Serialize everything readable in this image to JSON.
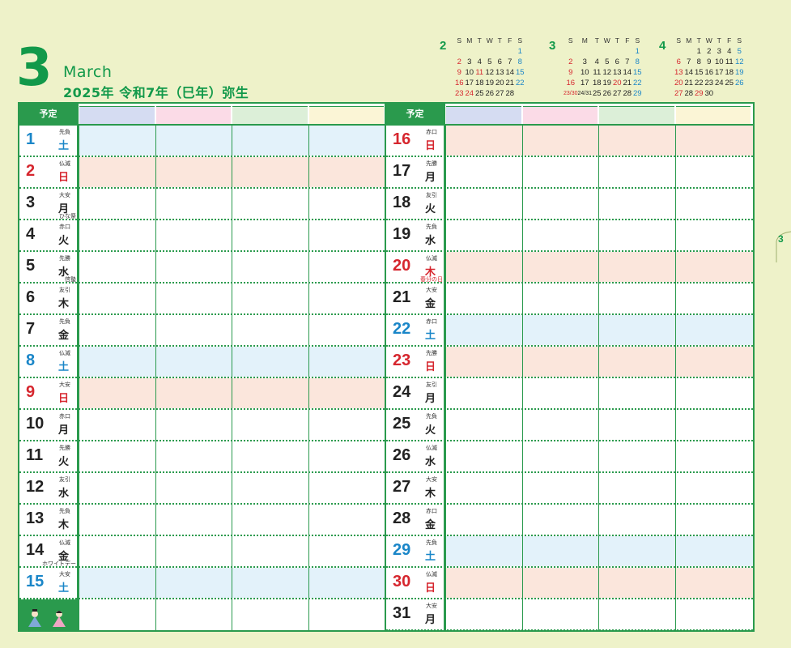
{
  "header": {
    "month_num": "3",
    "month_en": "March",
    "month_jp": "2025年 令和7年（巳年）弥生"
  },
  "mini_calendars": [
    {
      "month": "2",
      "headers": [
        "S",
        "M",
        "T",
        "W",
        "T",
        "F",
        "S"
      ],
      "weeks": [
        [
          "",
          "",
          "",
          "",
          "",
          "",
          "1"
        ],
        [
          "2",
          "3",
          "4",
          "5",
          "6",
          "7",
          "8"
        ],
        [
          "9",
          "10",
          "11",
          "12",
          "13",
          "14",
          "15"
        ],
        [
          "16",
          "17",
          "18",
          "19",
          "20",
          "21",
          "22"
        ],
        [
          "23",
          "24",
          "25",
          "26",
          "27",
          "28",
          ""
        ]
      ]
    },
    {
      "month": "3",
      "headers": [
        "S",
        "M",
        "T",
        "W",
        "T",
        "F",
        "S"
      ],
      "weeks": [
        [
          "",
          "",
          "",
          "",
          "",
          "",
          "1"
        ],
        [
          "2",
          "3",
          "4",
          "5",
          "6",
          "7",
          "8"
        ],
        [
          "9",
          "10",
          "11",
          "12",
          "13",
          "14",
          "15"
        ],
        [
          "16",
          "17",
          "18",
          "19",
          "20",
          "21",
          "22"
        ],
        [
          "23/30",
          "24/31",
          "25",
          "26",
          "27",
          "28",
          "29"
        ]
      ]
    },
    {
      "month": "4",
      "headers": [
        "S",
        "M",
        "T",
        "W",
        "T",
        "F",
        "S"
      ],
      "weeks": [
        [
          "",
          "",
          "1",
          "2",
          "3",
          "4",
          "5"
        ],
        [
          "6",
          "7",
          "8",
          "9",
          "10",
          "11",
          "12"
        ],
        [
          "13",
          "14",
          "15",
          "16",
          "17",
          "18",
          "19"
        ],
        [
          "20",
          "21",
          "22",
          "23",
          "24",
          "25",
          "26"
        ],
        [
          "27",
          "28",
          "29",
          "30",
          "",
          "",
          ""
        ]
      ]
    }
  ],
  "grid": {
    "yotei_label": "予定",
    "col_colors": [
      "#d5dcf2",
      "#fbdbe7",
      "#dcefd8",
      "#fbf5d6"
    ]
  },
  "days_left": [
    {
      "n": "1",
      "r": "先負",
      "d": "土",
      "type": "sat",
      "note": ""
    },
    {
      "n": "2",
      "r": "仏滅",
      "d": "日",
      "type": "sun",
      "note": ""
    },
    {
      "n": "3",
      "r": "大安",
      "d": "月",
      "type": "",
      "note": "ひな祭"
    },
    {
      "n": "4",
      "r": "赤口",
      "d": "火",
      "type": "",
      "note": ""
    },
    {
      "n": "5",
      "r": "先勝",
      "d": "水",
      "type": "",
      "note": "啓蟄"
    },
    {
      "n": "6",
      "r": "友引",
      "d": "木",
      "type": "",
      "note": ""
    },
    {
      "n": "7",
      "r": "先負",
      "d": "金",
      "type": "",
      "note": ""
    },
    {
      "n": "8",
      "r": "仏滅",
      "d": "土",
      "type": "sat",
      "note": ""
    },
    {
      "n": "9",
      "r": "大安",
      "d": "日",
      "type": "sun",
      "note": ""
    },
    {
      "n": "10",
      "r": "赤口",
      "d": "月",
      "type": "",
      "note": ""
    },
    {
      "n": "11",
      "r": "先勝",
      "d": "火",
      "type": "",
      "note": ""
    },
    {
      "n": "12",
      "r": "友引",
      "d": "水",
      "type": "",
      "note": ""
    },
    {
      "n": "13",
      "r": "先負",
      "d": "木",
      "type": "",
      "note": ""
    },
    {
      "n": "14",
      "r": "仏滅",
      "d": "金",
      "type": "",
      "note": "ホワイトデー"
    },
    {
      "n": "15",
      "r": "大安",
      "d": "土",
      "type": "sat",
      "note": ""
    }
  ],
  "days_right": [
    {
      "n": "16",
      "r": "赤口",
      "d": "日",
      "type": "sun",
      "note": ""
    },
    {
      "n": "17",
      "r": "先勝",
      "d": "月",
      "type": "",
      "note": ""
    },
    {
      "n": "18",
      "r": "友引",
      "d": "火",
      "type": "",
      "note": ""
    },
    {
      "n": "19",
      "r": "先負",
      "d": "水",
      "type": "",
      "note": ""
    },
    {
      "n": "20",
      "r": "仏滅",
      "d": "木",
      "type": "sun",
      "note": "春分の日"
    },
    {
      "n": "21",
      "r": "大安",
      "d": "金",
      "type": "",
      "note": ""
    },
    {
      "n": "22",
      "r": "赤口",
      "d": "土",
      "type": "sat",
      "note": ""
    },
    {
      "n": "23",
      "r": "先勝",
      "d": "日",
      "type": "sun",
      "note": ""
    },
    {
      "n": "24",
      "r": "友引",
      "d": "月",
      "type": "",
      "note": ""
    },
    {
      "n": "25",
      "r": "先負",
      "d": "火",
      "type": "",
      "note": ""
    },
    {
      "n": "26",
      "r": "仏滅",
      "d": "水",
      "type": "",
      "note": ""
    },
    {
      "n": "27",
      "r": "大安",
      "d": "木",
      "type": "",
      "note": ""
    },
    {
      "n": "28",
      "r": "赤口",
      "d": "金",
      "type": "",
      "note": ""
    },
    {
      "n": "29",
      "r": "先負",
      "d": "土",
      "type": "sat",
      "note": ""
    },
    {
      "n": "30",
      "r": "仏滅",
      "d": "日",
      "type": "sun",
      "note": ""
    },
    {
      "n": "31",
      "r": "大安",
      "d": "月",
      "type": "",
      "note": ""
    }
  ],
  "side_tab": "3"
}
